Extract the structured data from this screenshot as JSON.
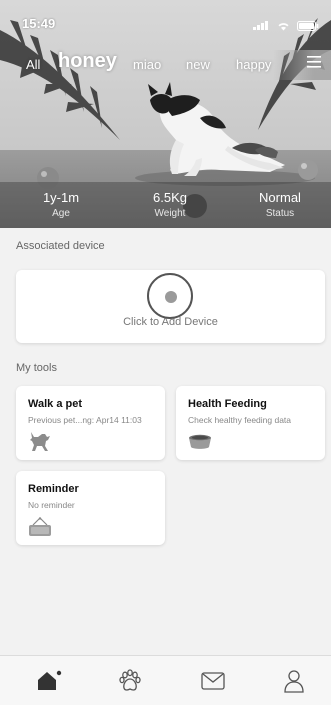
{
  "status_bar": {
    "time": "15:49"
  },
  "pet_tabs": [
    {
      "label": "All"
    },
    {
      "label": "honey"
    },
    {
      "label": "miao"
    },
    {
      "label": "new"
    },
    {
      "label": "happy"
    }
  ],
  "pet_stats": [
    {
      "value": "1y-1m",
      "label": "Age"
    },
    {
      "value": "6.5Kg",
      "label": "Weight"
    },
    {
      "value": "Normal",
      "label": "Status"
    }
  ],
  "associated_device": {
    "title": "Associated device",
    "add_label": "Click to Add Device"
  },
  "my_tools": {
    "title": "My tools",
    "items": [
      {
        "title": "Walk a pet",
        "subtitle": "Previous pet...ng: Apr14 11:03",
        "icon": "dog-icon"
      },
      {
        "title": "Health Feeding",
        "subtitle": "Check healthy feeding data",
        "icon": "food-bowl-icon"
      },
      {
        "title": "Reminder",
        "subtitle": "No reminder",
        "icon": "open-sign-icon"
      }
    ]
  },
  "bottom_nav": [
    {
      "icon": "home-icon"
    },
    {
      "icon": "paw-icon"
    },
    {
      "icon": "mail-icon"
    },
    {
      "icon": "profile-icon"
    }
  ]
}
